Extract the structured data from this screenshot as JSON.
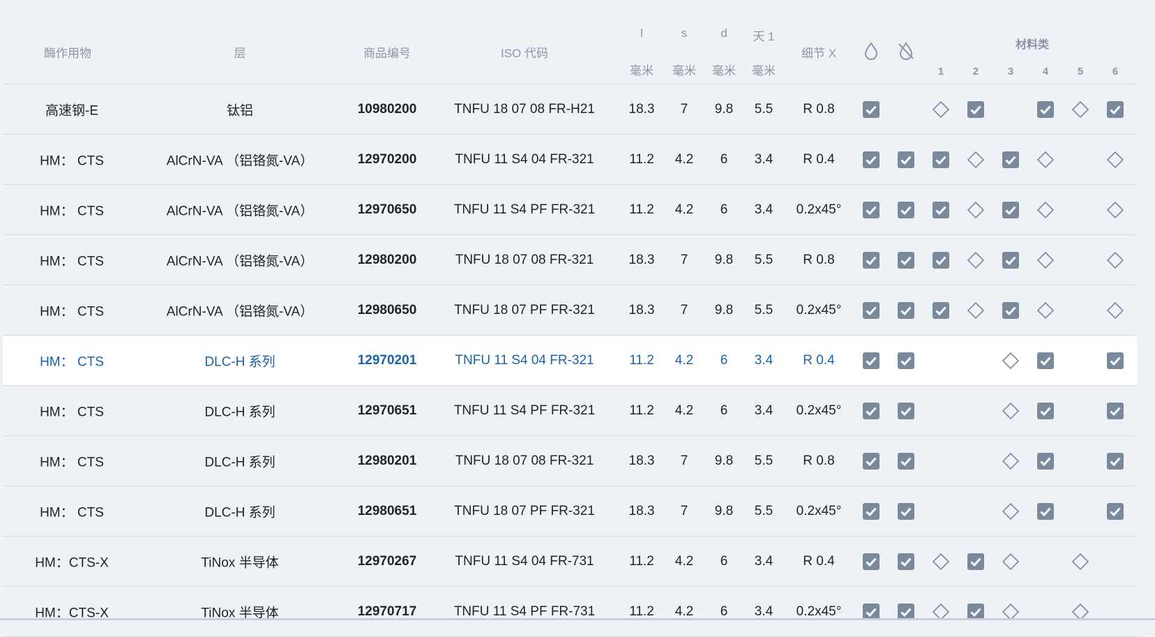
{
  "header": {
    "enzyme": "酶作用物",
    "layer": "层",
    "item_no": "商品编号",
    "iso": "ISO 代码",
    "l": "l",
    "s": "s",
    "d": "d",
    "day1": "天 1",
    "mm": "毫米",
    "detail": "细节 X",
    "coolant_icon": "droplet-icon",
    "dry_icon": "no-droplet-icon",
    "material_group": "材料类",
    "material_cols": [
      "1",
      "2",
      "3",
      "4",
      "5",
      "6"
    ]
  },
  "marks_legend": {
    "check": "checkbox-checked-icon",
    "diamond": "diamond-outline-icon"
  },
  "colors": {
    "accent": "#1a63a8",
    "check_fill": "#7a8a9c",
    "background": "#eef2f7",
    "selected_row": "#ffffff"
  },
  "rows": [
    {
      "enzyme": "高速钢-E",
      "layer": "钛铝",
      "item": "10980200",
      "iso": "TNFU 18 07 08 FR-H21",
      "l": "18.3",
      "s": "7",
      "d": "9.8",
      "t": "5.5",
      "detail": "R 0.8",
      "marks": [
        "check",
        "",
        "diamond",
        "check",
        "",
        "check",
        "diamond",
        "check"
      ]
    },
    {
      "enzyme": "HM： CTS",
      "layer": "AlCrN-VA （铝铬氮-VA）",
      "item": "12970200",
      "iso": "TNFU 11 S4 04 FR-321",
      "l": "11.2",
      "s": "4.2",
      "d": "6",
      "t": "3.4",
      "detail": "R 0.4",
      "marks": [
        "check",
        "check",
        "check",
        "diamond",
        "check",
        "diamond",
        "",
        "diamond"
      ]
    },
    {
      "enzyme": "HM： CTS",
      "layer": "AlCrN-VA （铝铬氮-VA）",
      "item": "12970650",
      "iso": "TNFU 11 S4 PF FR-321",
      "l": "11.2",
      "s": "4.2",
      "d": "6",
      "t": "3.4",
      "detail": "0.2x45°",
      "marks": [
        "check",
        "check",
        "check",
        "diamond",
        "check",
        "diamond",
        "",
        "diamond"
      ]
    },
    {
      "enzyme": "HM： CTS",
      "layer": "AlCrN-VA （铝铬氮-VA）",
      "item": "12980200",
      "iso": "TNFU 18 07 08 FR-321",
      "l": "18.3",
      "s": "7",
      "d": "9.8",
      "t": "5.5",
      "detail": "R 0.8",
      "marks": [
        "check",
        "check",
        "check",
        "diamond",
        "check",
        "diamond",
        "",
        "diamond"
      ]
    },
    {
      "enzyme": "HM： CTS",
      "layer": "AlCrN-VA （铝铬氮-VA）",
      "item": "12980650",
      "iso": "TNFU 18 07 PF FR-321",
      "l": "18.3",
      "s": "7",
      "d": "9.8",
      "t": "5.5",
      "detail": "0.2x45°",
      "marks": [
        "check",
        "check",
        "check",
        "diamond",
        "check",
        "diamond",
        "",
        "diamond"
      ]
    },
    {
      "enzyme": "HM： CTS",
      "layer": "DLC-H 系列",
      "item": "12970201",
      "iso": "TNFU 11 S4 04 FR-321",
      "l": "11.2",
      "s": "4.2",
      "d": "6",
      "t": "3.4",
      "detail": "R 0.4",
      "selected": true,
      "marks": [
        "check",
        "check",
        "",
        "",
        "diamond",
        "check",
        "",
        "check"
      ]
    },
    {
      "enzyme": "HM： CTS",
      "layer": "DLC-H 系列",
      "item": "12970651",
      "iso": "TNFU 11 S4 PF FR-321",
      "l": "11.2",
      "s": "4.2",
      "d": "6",
      "t": "3.4",
      "detail": "0.2x45°",
      "marks": [
        "check",
        "check",
        "",
        "",
        "diamond",
        "check",
        "",
        "check"
      ]
    },
    {
      "enzyme": "HM： CTS",
      "layer": "DLC-H 系列",
      "item": "12980201",
      "iso": "TNFU 18 07 08 FR-321",
      "l": "18.3",
      "s": "7",
      "d": "9.8",
      "t": "5.5",
      "detail": "R 0.8",
      "marks": [
        "check",
        "check",
        "",
        "",
        "diamond",
        "check",
        "",
        "check"
      ]
    },
    {
      "enzyme": "HM： CTS",
      "layer": "DLC-H 系列",
      "item": "12980651",
      "iso": "TNFU 18 07 PF FR-321",
      "l": "18.3",
      "s": "7",
      "d": "9.8",
      "t": "5.5",
      "detail": "0.2x45°",
      "marks": [
        "check",
        "check",
        "",
        "",
        "diamond",
        "check",
        "",
        "check"
      ]
    },
    {
      "enzyme": "HM：CTS-X",
      "layer": "TiNox 半导体",
      "item": "12970267",
      "iso": "TNFU 11 S4 04 FR-731",
      "l": "11.2",
      "s": "4.2",
      "d": "6",
      "t": "3.4",
      "detail": "R 0.4",
      "marks": [
        "check",
        "check",
        "diamond",
        "check",
        "diamond",
        "",
        "diamond",
        ""
      ]
    },
    {
      "enzyme": "HM：CTS-X",
      "layer": "TiNox 半导体",
      "item": "12970717",
      "iso": "TNFU 11 S4 PF FR-731",
      "l": "11.2",
      "s": "4.2",
      "d": "6",
      "t": "3.4",
      "detail": "0.2x45°",
      "marks": [
        "check",
        "check",
        "diamond",
        "check",
        "diamond",
        "",
        "diamond",
        ""
      ]
    }
  ]
}
